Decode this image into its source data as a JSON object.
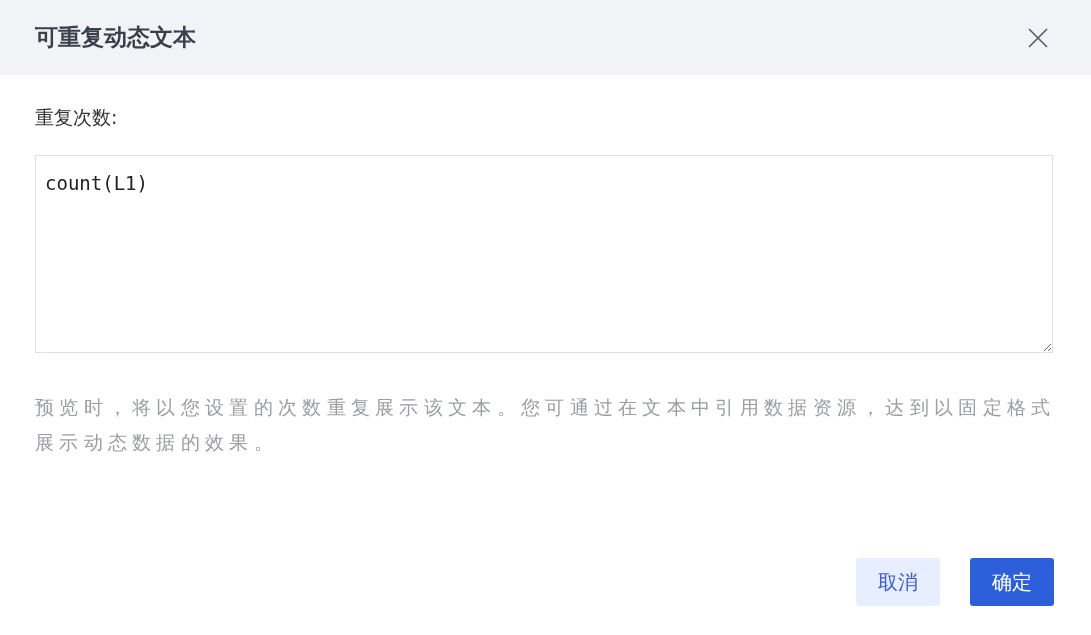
{
  "dialog": {
    "title": "可重复动态文本"
  },
  "field": {
    "label": "重复次数:",
    "value": "count(L1)"
  },
  "hint": "预览时，将以您设置的次数重复展示该文本。您可通过在文本中引用数据资源，达到以固定格式展示动态数据的效果。",
  "buttons": [
    {
      "label": "取消",
      "kind": "secondary"
    },
    {
      "label": "确定",
      "kind": "primary"
    }
  ]
}
